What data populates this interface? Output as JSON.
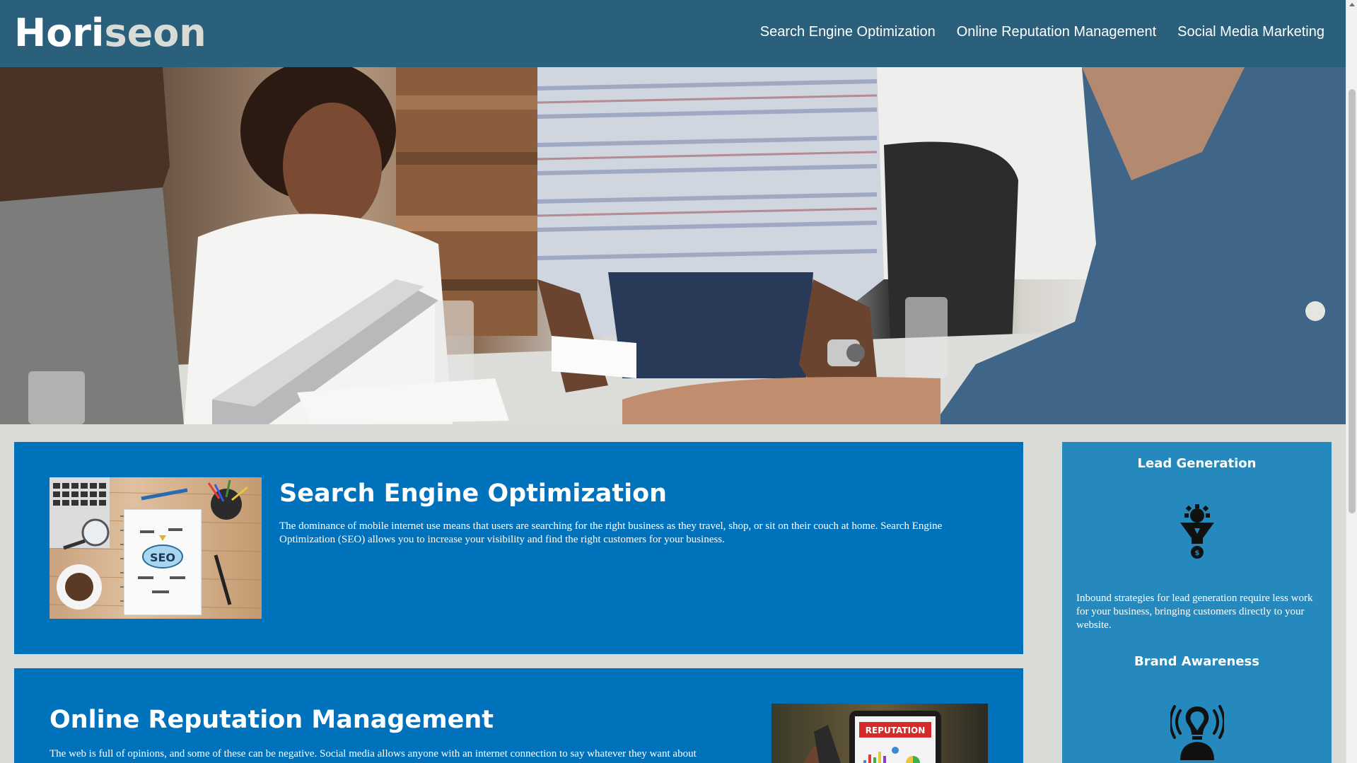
{
  "header": {
    "logo_part1": "Hori",
    "logo_part2": "seon",
    "nav": [
      {
        "label": "Search Engine Optimization"
      },
      {
        "label": "Online Reputation Management"
      },
      {
        "label": "Social Media Marketing"
      }
    ]
  },
  "content": {
    "seo": {
      "title": "Search Engine Optimization",
      "text": "The dominance of mobile internet use means that users are searching for the right business as they travel, shop, or sit on their couch at home. Search Engine Optimization (SEO) allows you to increase your visibility and find the right customers for your business.",
      "image_text": "SEO"
    },
    "orm": {
      "title": "Online Reputation Management",
      "text": "The web is full of opinions, and some of these can be negative. Social media allows anyone with an internet connection to say whatever they want about",
      "image_text": "REPUTATION"
    }
  },
  "sidebar": {
    "lead": {
      "title": "Lead Generation",
      "text": "Inbound strategies for lead generation require less work for your business, bringing customers directly to your website.",
      "icon": "lead-funnel-icon"
    },
    "brand": {
      "title": "Brand Awareness",
      "icon": "brand-lightbulb-icon"
    }
  },
  "colors": {
    "header_bg": "#2a607c",
    "page_bg": "#d9dcd6",
    "card_bg": "#0072bb",
    "sidebar_bg": "#2589bd"
  }
}
